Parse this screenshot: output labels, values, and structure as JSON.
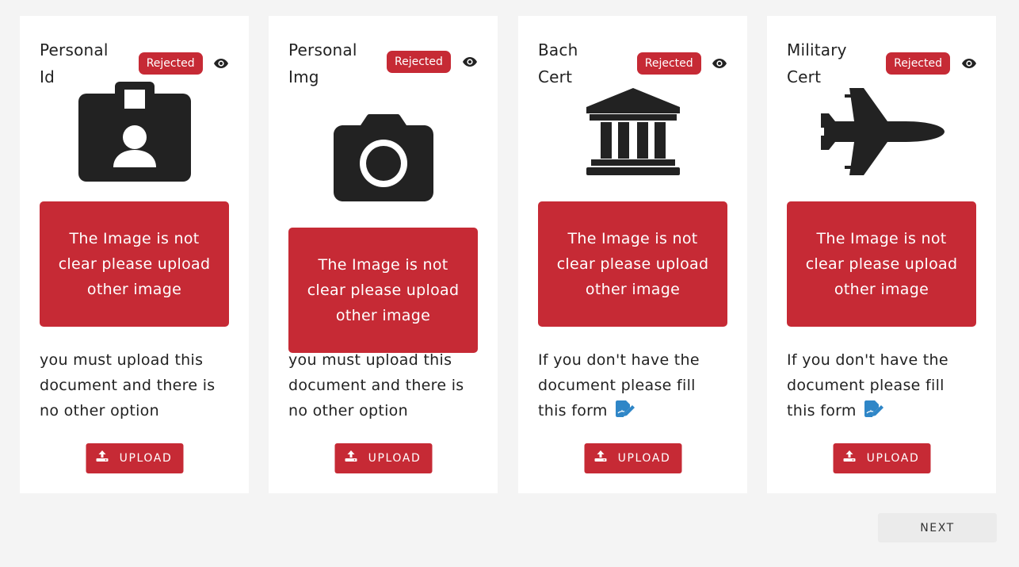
{
  "colors": {
    "accent": "#c62a35",
    "link_icon": "#2f86c7",
    "icon_dark": "#222222"
  },
  "cards": [
    {
      "title": "Personal Id",
      "status": "Rejected",
      "icon": "id-badge-icon",
      "alert": "The Image is not clear please upload other image",
      "description": "you must upload this document and there is no other option",
      "has_form_link": false,
      "upload_label": "UPLOAD"
    },
    {
      "title": "Personal Img",
      "status": "Rejected",
      "icon": "camera-icon",
      "alert": "The Image is not clear please upload other image",
      "description": "you must upload this document and there is no other option",
      "has_form_link": false,
      "upload_label": "UPLOAD"
    },
    {
      "title": "Bach Cert",
      "status": "Rejected",
      "icon": "university-icon",
      "alert": "The Image is not clear please upload other image",
      "description": "If you don't have the document please fill this form",
      "has_form_link": true,
      "form_icon": "edit-form-icon",
      "upload_label": "UPLOAD"
    },
    {
      "title": "Military Cert",
      "status": "Rejected",
      "icon": "fighter-jet-icon",
      "alert": "The Image is not clear please upload other image",
      "description": "If you don't have the document please fill this form",
      "has_form_link": true,
      "form_icon": "edit-form-icon",
      "upload_label": "UPLOAD"
    }
  ],
  "footer": {
    "next_label": "NEXT"
  }
}
